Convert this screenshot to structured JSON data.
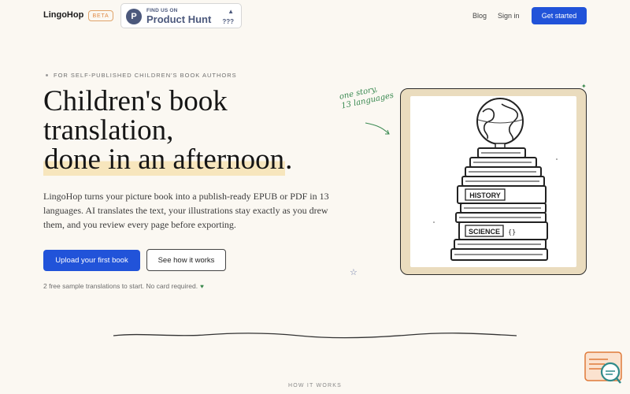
{
  "header": {
    "brand": "LingoHop",
    "badge": "BETA",
    "product_hunt": {
      "small": "FIND US ON",
      "big": "Product Hunt",
      "logo_letter": "P",
      "upvote_icon": "triangle-up-icon",
      "count": "???"
    },
    "nav": {
      "blog": "Blog",
      "signin": "Sign in",
      "cta": "Get started"
    }
  },
  "hero": {
    "eyebrow": "FOR SELF-PUBLISHED CHILDREN'S BOOK AUTHORS",
    "title_line1": "Children's book",
    "title_line2": "translation,",
    "title_line3_highlight": "done in an afternoon",
    "title_line3_end": ".",
    "description": "LingoHop turns your picture book into a publish-ready EPUB or PDF in 13 languages. AI translates the text, your illustrations stay exactly as you drew them, and you review every page before exporting.",
    "primary_button": "Upload your first book",
    "secondary_button": "See how it works",
    "note": "2 free sample translations to start. No card required.",
    "note_icon": "heart-icon"
  },
  "illustration": {
    "annotation_line1": "one story,",
    "annotation_line2": "13 languages",
    "book_labels": [
      "HISTORY",
      "SCIENCE"
    ],
    "icons": [
      "globe-icon",
      "book-stack-illustration",
      "sparkle-icon",
      "star-icon"
    ]
  },
  "section": {
    "how_label": "HOW IT WORKS"
  },
  "widget": {
    "icon": "help-chat-icon"
  },
  "colors": {
    "accent": "#2153d9",
    "highlight": "#f7e6bd",
    "green": "#3c8a4f",
    "background": "#fbf8f2"
  }
}
